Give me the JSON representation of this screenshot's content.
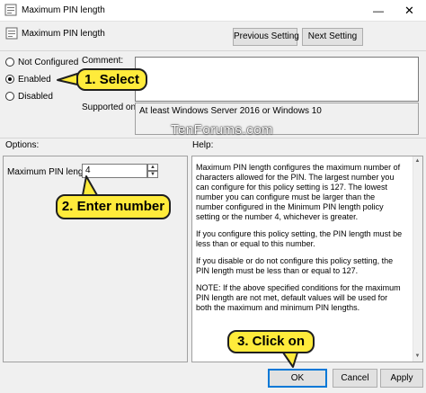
{
  "window": {
    "title": "Maximum PIN length",
    "minimize_glyph": "—",
    "close_glyph": "✕"
  },
  "header": {
    "policy_name": "Maximum PIN length",
    "previous_label": "Previous Setting",
    "next_label": "Next Setting"
  },
  "state": {
    "options": [
      {
        "label": "Not Configured",
        "checked": false
      },
      {
        "label": "Enabled",
        "checked": true
      },
      {
        "label": "Disabled",
        "checked": false
      }
    ]
  },
  "comment": {
    "label": "Comment:",
    "value": ""
  },
  "supported": {
    "label": "Supported on:",
    "value": "At least Windows Server 2016 or Windows 10"
  },
  "watermark": "TenForums.com",
  "options_panel": {
    "heading": "Options:",
    "field_label": "Maximum PIN length",
    "field_value": "4"
  },
  "help_panel": {
    "heading": "Help:",
    "paragraphs": [
      "Maximum PIN length configures the maximum number of characters allowed for the PIN.  The largest number you can configure for this policy setting is 127. The lowest number you can configure must be larger than the number configured in the Minimum PIN length policy setting or the number 4, whichever is greater.",
      "If you configure this policy setting, the PIN length must be less than or equal to this number.",
      "If you disable or do not configure this policy setting, the PIN length must be less than or equal to 127.",
      "NOTE: If the above specified conditions for the maximum PIN length are not met, default values will be used for both the maximum and minimum PIN lengths."
    ]
  },
  "footer": {
    "ok_label": "OK",
    "cancel_label": "Cancel",
    "apply_label": "Apply"
  },
  "callouts": {
    "step1": "1. Select",
    "step2": "2. Enter number",
    "step3": "3. Click on"
  },
  "colors": {
    "callout_fill": "#ffeb3b",
    "ok_border": "#0078d7"
  }
}
